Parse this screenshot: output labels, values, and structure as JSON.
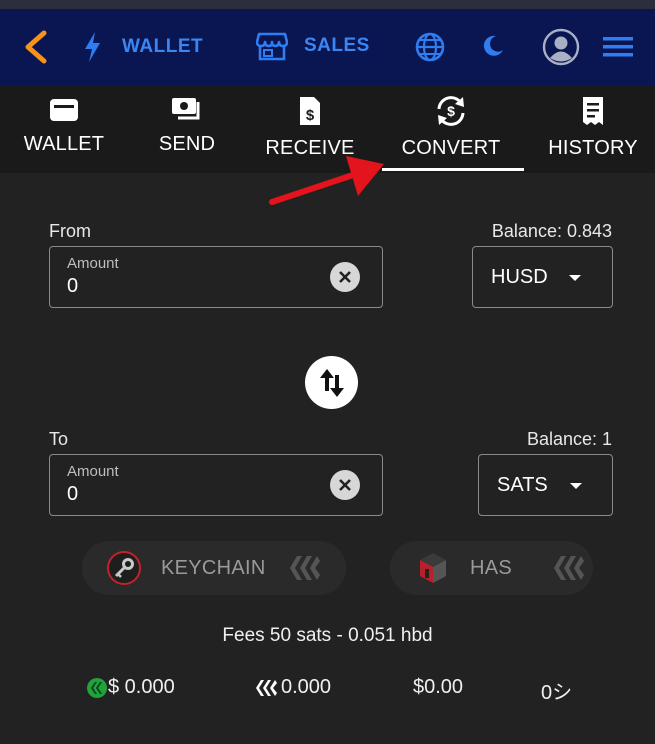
{
  "nav": {
    "wallet_label": "WALLET",
    "sales_label": "SALES"
  },
  "tabs": [
    {
      "label": "WALLET"
    },
    {
      "label": "SEND"
    },
    {
      "label": "RECEIVE"
    },
    {
      "label": "CONVERT"
    },
    {
      "label": "HISTORY"
    }
  ],
  "form": {
    "from_label": "From",
    "from_balance": "Balance: 0.843",
    "from_amount_label": "Amount",
    "from_amount_value": "0",
    "from_currency": "HUSD",
    "to_label": "To",
    "to_balance": "Balance: 1",
    "to_amount_label": "Amount",
    "to_amount_value": "0",
    "to_currency": "SATS"
  },
  "actions": {
    "keychain_label": "KEYCHAIN",
    "has_label": "HAS"
  },
  "fees_text": "Fees 50 sats - 0.051 hbd",
  "balances": {
    "hbd": "$ 0.000",
    "hive": "0.000",
    "usd": "$0.00",
    "sats": "0シ"
  },
  "colors": {
    "navbar": "#0a1652",
    "nav_accent": "#3a86f2",
    "back_arrow": "#f7931a",
    "annotation_arrow": "#e3141b"
  },
  "icons": [
    "back-icon",
    "lightning-icon",
    "store-icon",
    "globe-icon",
    "moon-icon",
    "account-icon",
    "menu-icon",
    "wallet-icon",
    "send-money-icon",
    "receive-icon",
    "convert-icon",
    "history-icon",
    "close-circle-icon",
    "swap-icon",
    "keychain-icon",
    "hive-icon",
    "has-icon",
    "hbd-icon"
  ]
}
